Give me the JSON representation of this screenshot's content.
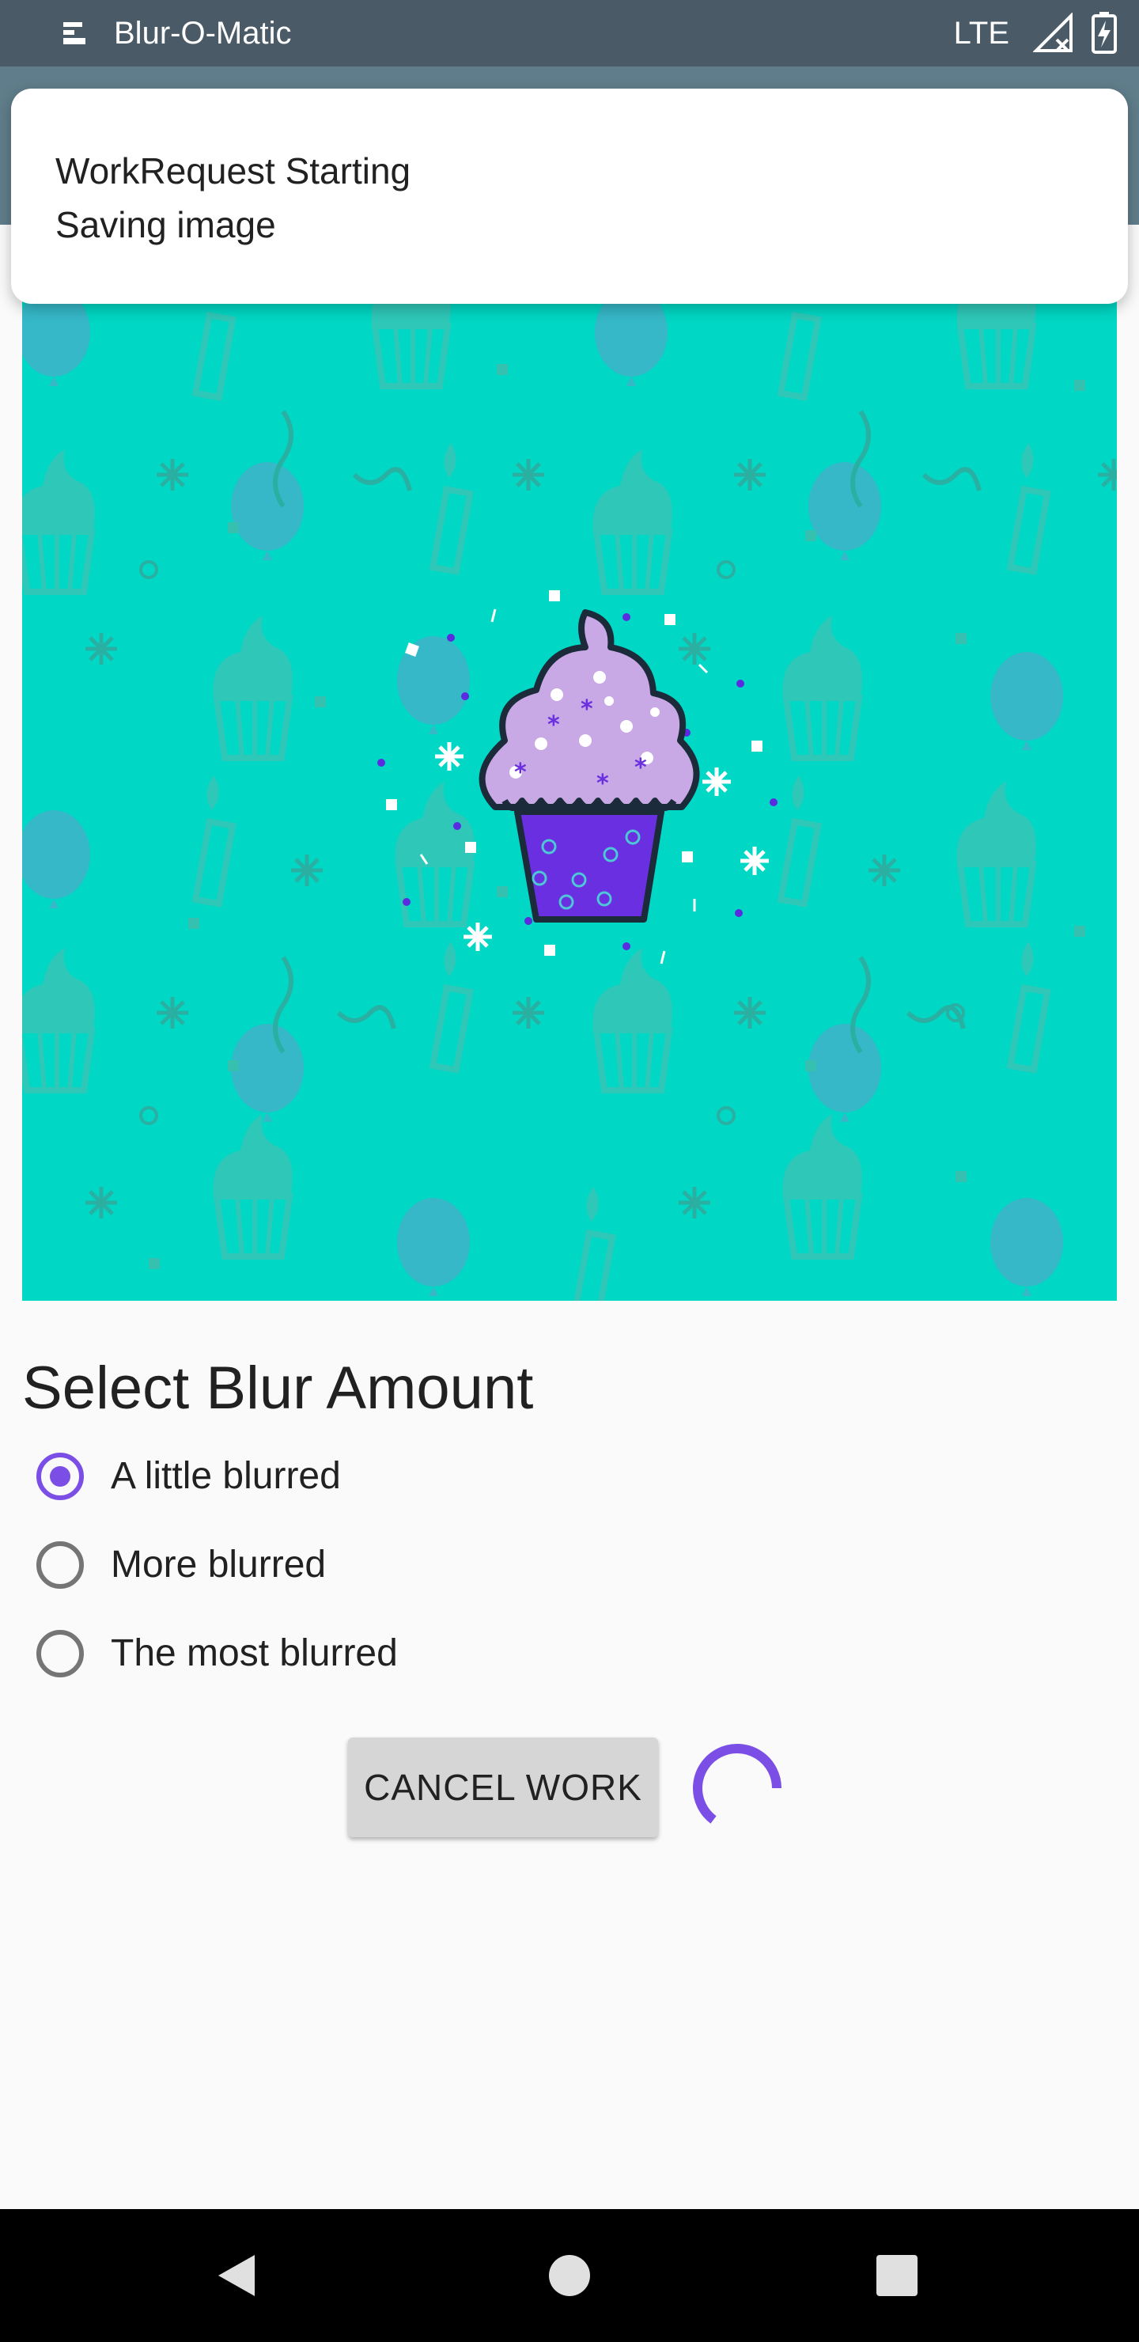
{
  "status_bar": {
    "app_name": "Blur-O-Matic",
    "network": "LTE",
    "icons": [
      "notification-icon",
      "signal-icon",
      "battery-charging-icon"
    ]
  },
  "notification": {
    "title": "WorkRequest Starting",
    "text": "Saving image"
  },
  "image": {
    "subject": "cupcake-illustration",
    "background_color": "#00d7c4"
  },
  "blur": {
    "title": "Select Blur Amount",
    "options": [
      {
        "label": "A little blurred",
        "checked": true
      },
      {
        "label": "More blurred",
        "checked": false
      },
      {
        "label": "The most blurred",
        "checked": false
      }
    ]
  },
  "actions": {
    "cancel_label": "CANCEL WORK",
    "progress_state": "indeterminate"
  },
  "nav_bar": {
    "buttons": [
      "back-icon",
      "home-icon",
      "recents-icon"
    ]
  },
  "colors": {
    "accent": "#7b4fe6",
    "toolbar": "#607d8b",
    "status_bar": "#4a5a66"
  }
}
